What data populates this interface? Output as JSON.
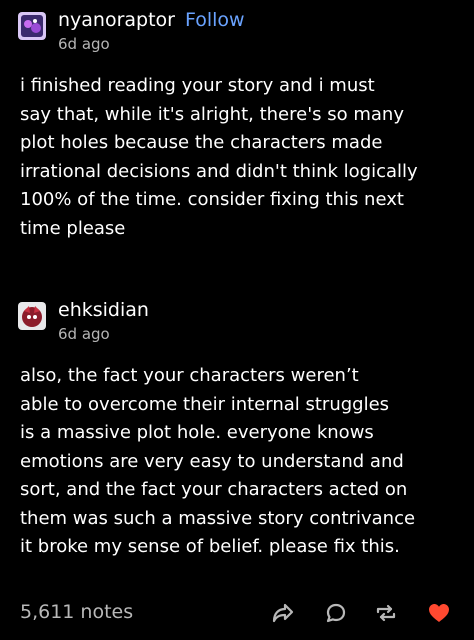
{
  "post1": {
    "username": "nyanoraptor",
    "follow_label": "Follow",
    "timestamp": "6d ago",
    "avatar_icon": "avatar-purple-icon",
    "body": "i finished reading your story and i must\nsay that, while it's alright, there's so many\nplot holes because the characters made\nirrational decisions and didn't think logically\n100% of the time. consider fixing this next\ntime please"
  },
  "post2": {
    "username": "ehksidian",
    "timestamp": "6d ago",
    "avatar_icon": "avatar-red-icon",
    "body": "also, the fact your characters weren’t\nable to overcome their internal struggles\nis a massive plot hole. everyone knows\nemotions are very easy to understand and\nsort, and the fact your characters acted on\nthem was such a massive story contrivance\nit broke my sense of belief. please fix this."
  },
  "footer": {
    "notes_label": "5,611 notes",
    "icons": [
      "share-icon",
      "reply-icon",
      "reblog-icon",
      "heart-icon"
    ]
  },
  "colors": {
    "background": "#000000",
    "text": "#ffffff",
    "muted": "#b5b5b5",
    "follow": "#6aa3ff",
    "like": "#ff4930"
  }
}
